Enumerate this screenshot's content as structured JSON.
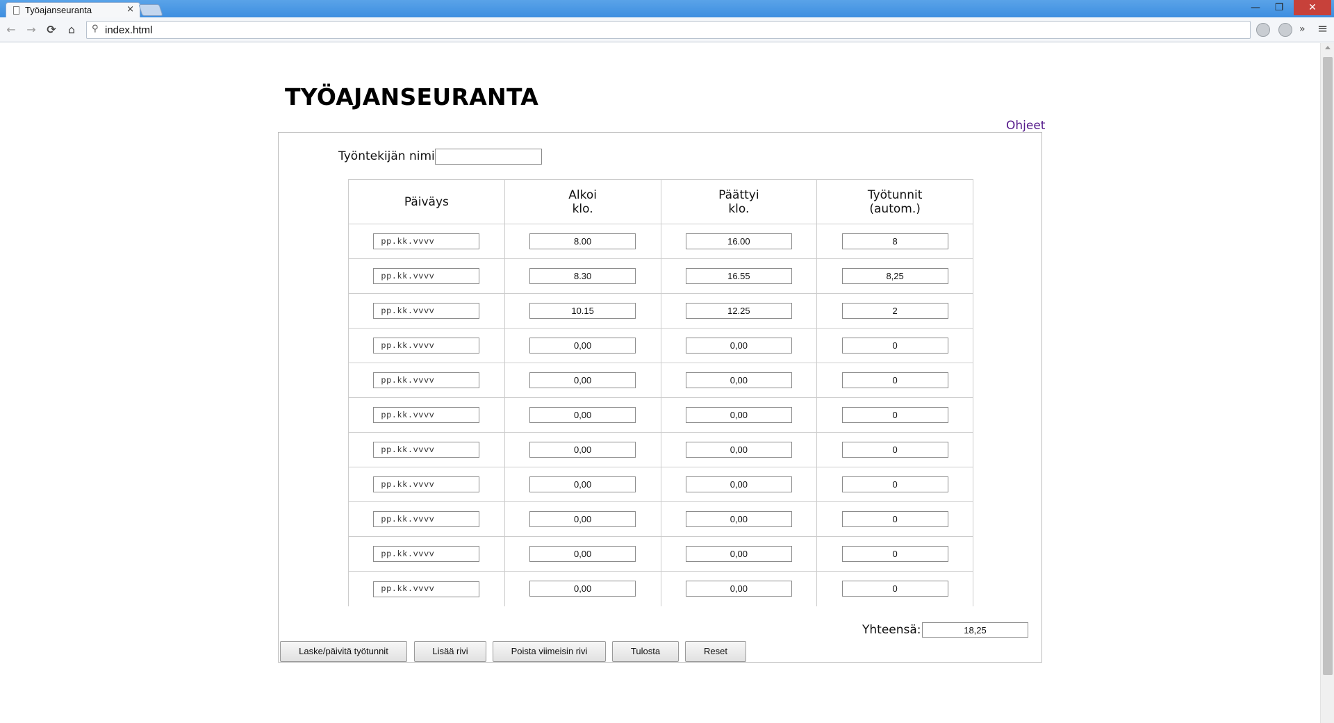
{
  "browser": {
    "tab_title": "Työajanseuranta",
    "tab_close": "×",
    "url": "index.html",
    "window_controls": {
      "minimize": "—",
      "maximize": "❐",
      "close": "✕"
    },
    "nav": {
      "back": "←",
      "forward": "→",
      "reload": "⟳",
      "home": "⌂",
      "search_glyph": "⚲",
      "overflow": "»",
      "menu": "≡"
    }
  },
  "page": {
    "title": "TYÖAJANSEURANTA",
    "help_link": "Ohjeet",
    "employee_label": "Työntekijän nimi:",
    "employee_value": ""
  },
  "table": {
    "headers": [
      "Päiväys",
      "Alkoi\nklo.",
      "Päättyi\nklo.",
      "Työtunnit\n(autom.)"
    ],
    "rows": [
      {
        "date": "pp.kk.vvvv",
        "start": "8.00",
        "end": "16.00",
        "hours": "8"
      },
      {
        "date": "pp.kk.vvvv",
        "start": "8.30",
        "end": "16.55",
        "hours": "8,25"
      },
      {
        "date": "pp.kk.vvvv",
        "start": "10.15",
        "end": "12.25",
        "hours": "2"
      },
      {
        "date": "pp.kk.vvvv",
        "start": "0,00",
        "end": "0,00",
        "hours": "0"
      },
      {
        "date": "pp.kk.vvvv",
        "start": "0,00",
        "end": "0,00",
        "hours": "0"
      },
      {
        "date": "pp.kk.vvvv",
        "start": "0,00",
        "end": "0,00",
        "hours": "0"
      },
      {
        "date": "pp.kk.vvvv",
        "start": "0,00",
        "end": "0,00",
        "hours": "0"
      },
      {
        "date": "pp.kk.vvvv",
        "start": "0,00",
        "end": "0,00",
        "hours": "0"
      },
      {
        "date": "pp.kk.vvvv",
        "start": "0,00",
        "end": "0,00",
        "hours": "0"
      },
      {
        "date": "pp.kk.vvvv",
        "start": "0,00",
        "end": "0,00",
        "hours": "0"
      },
      {
        "date": "pp.kk.vvvv",
        "start": "0,00",
        "end": "0,00",
        "hours": "0"
      }
    ]
  },
  "total": {
    "label": "Yhteensä:",
    "value": "18,25"
  },
  "buttons": {
    "calculate": "Laske/päivitä työtunnit",
    "add_row": "Lisää rivi",
    "remove_last": "Poista viimeisin rivi",
    "print": "Tulosta",
    "reset": "Reset"
  },
  "colors": {
    "link": "#551a8b",
    "titlebar": "#3d8ee0",
    "close_button": "#c7413a"
  }
}
